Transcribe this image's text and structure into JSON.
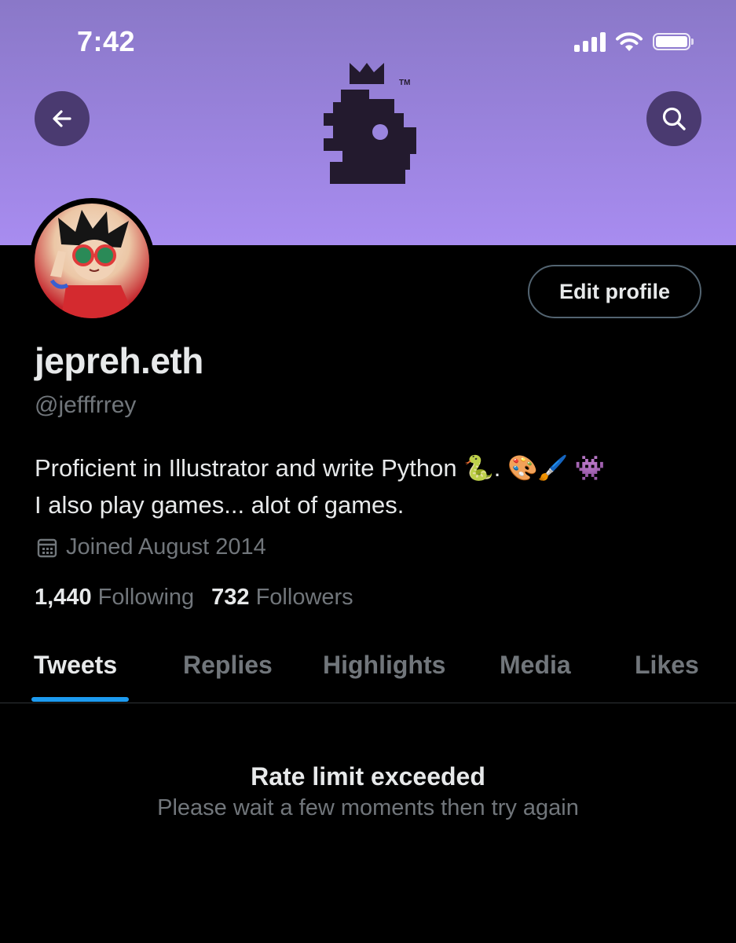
{
  "status_bar": {
    "time": "7:42",
    "icons": [
      "cellular-signal-icon",
      "wifi-icon",
      "battery-icon"
    ]
  },
  "header": {
    "back_icon": "arrow-left-icon",
    "search_icon": "search-icon",
    "banner_logo": "crowned-creature-logo",
    "banner_trademark": "TM",
    "banner_colors": [
      "#8a78c8",
      "#a88cf0"
    ]
  },
  "profile": {
    "display_name": "jepreh.eth",
    "handle": "@jefffrrey",
    "bio_line1": "Proficient in Illustrator and write Python 🐍. 🎨🖌️ 👾",
    "bio_line2": "I also play games... alot of games.",
    "joined": "Joined August 2014",
    "joined_icon": "calendar-icon",
    "edit_button": "Edit profile",
    "following_count": "1,440",
    "following_label": "Following",
    "followers_count": "732",
    "followers_label": "Followers"
  },
  "tabs": [
    {
      "label": "Tweets",
      "active": true
    },
    {
      "label": "Replies",
      "active": false
    },
    {
      "label": "Highlights",
      "active": false
    },
    {
      "label": "Media",
      "active": false
    },
    {
      "label": "Likes",
      "active": false
    }
  ],
  "message": {
    "title": "Rate limit exceeded",
    "subtitle": "Please wait a few moments then try again"
  },
  "colors": {
    "background": "#000000",
    "primary_text": "#e7e9ea",
    "secondary_text": "#71767b",
    "accent": "#1d9bf0",
    "header_button": "#4a3a70"
  }
}
